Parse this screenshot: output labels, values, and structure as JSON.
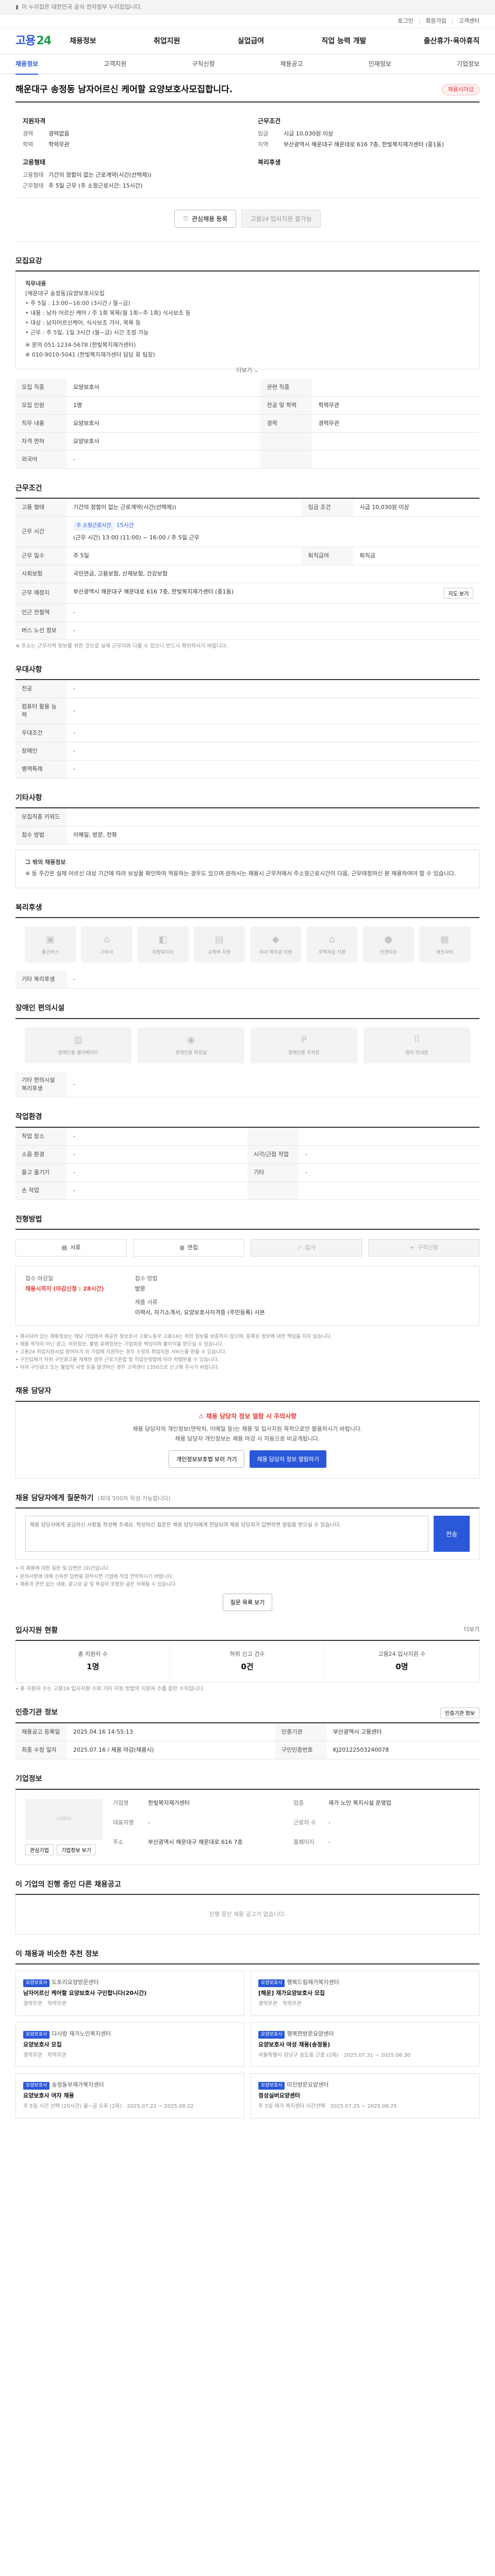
{
  "topbar": {
    "notice": "이 누리집은 대한민국 공식 전자정부 누리집입니다."
  },
  "topstrip": {
    "links": [
      "로그인",
      "회원가입",
      "고객센터"
    ]
  },
  "gnb": {
    "logo_a": "고용",
    "logo_b": "24",
    "menu": [
      "채용정보",
      "취업지원",
      "실업급여",
      "직업 능력 개발",
      "출산휴가·육아휴직"
    ]
  },
  "tabs": [
    "채용정보",
    "고객지원",
    "구직신청",
    "채용공고",
    "인재정보",
    "기업정보"
  ],
  "title": "해운대구 송정동 남자어르신 케어할 요양보호사모집합니다.",
  "closing_badge": "채용시마감",
  "summary": {
    "left_title": "지원자격",
    "left": [
      {
        "k": "경력",
        "v": "경력없음"
      },
      {
        "k": "학력",
        "v": "학력무관"
      }
    ],
    "right_title": "근무조건",
    "right": [
      {
        "k": "임금",
        "v": "시급 10,030원 이상"
      },
      {
        "k": "지역",
        "v": "부산광역시 해운대구 해운대로 616 7층, 한빛복지재가센터 (중1동)"
      }
    ],
    "left2_title": "고용형태",
    "left2": [
      {
        "k": "고용형태",
        "v": "기간의 정함이 없는 근로계약(시간(선택제))"
      },
      {
        "k": "근무형태",
        "v": "주 5일 근무 (주 소정근로시간: 15시간)"
      }
    ],
    "right2_title": "복리후생",
    "right2": []
  },
  "buttons": {
    "save": "관심채용 등록",
    "apply": "고용24 입사지원 불가능"
  },
  "sec_detail": {
    "title": "모집요강",
    "lines": [
      "직무내용",
      "[해운대구 송정동]요양보호사모집",
      "• 주 5일 : 13:00~16:00 (3시간 / 월~금)",
      "• 내용 : 남자 어르신 케어 / 주 1회 목욕(월 1회~주 1회) 식사보조 등",
      "• 대상 : 남자어르신케어, 식사보조 가사, 목욕 등",
      "• 근무 : 주 5일, 1일 3시간 (월~금) 시간 조정 가능",
      "",
      "※ 문의 051-1234-5678 (한빛복지재가센터)",
      "",
      "※ 010-9010-5041 (한빛복지재가센터 담당 류 팀장)"
    ],
    "more": "더보기"
  },
  "sec_job": {
    "title": "",
    "rows": [
      [
        {
          "k": "모집 직종",
          "v": "요양보호사"
        },
        {
          "k": "관련 직종",
          "v": ""
        }
      ],
      [
        {
          "k": "모집 인원",
          "v": "1명"
        },
        {
          "k": "전공 및 학력",
          "v": "학력무관"
        }
      ],
      [
        {
          "k": "직무 내용",
          "v": "요양보호사"
        },
        {
          "k": "경력",
          "v": "경력무관"
        }
      ],
      [
        {
          "k": "자격 면허",
          "v": "요양보호사"
        },
        {
          "k": "",
          "v": ""
        }
      ],
      [
        {
          "k": "외국어",
          "v": "-"
        },
        {
          "k": "",
          "v": ""
        }
      ]
    ]
  },
  "sec_work": {
    "title": "근무조건",
    "employment": "기간의 정함이 없는 근로계약(시간(선택제))",
    "wage_label": "임금 조건",
    "wage": "시급 10,030원 이상",
    "hours_label": "근무 시간",
    "hours_tag": "주 소정근로시간",
    "hours_value": "15시간",
    "schedule": "(근무 시간) 13:00 (11:00) ~ 16:00 / 주 5일 근무",
    "days": "주 5일",
    "insurance": "국민연금, 고용보험, 산재보험, 건강보험",
    "severance": "퇴직금",
    "location": "부산광역시 해운대구 해운대로 616 7층, 한빛복지재가센터 (중1동)",
    "map_btn": "지도 보기",
    "note": "※ 주소는 근무지역 정보를 위한 것으로 실제 근무지와 다를 수 있으니 반드시 확인하시기 바랍니다."
  },
  "sec_pref": {
    "title": "우대사항",
    "rows": [
      {
        "k": "전공",
        "v": "-"
      },
      {
        "k": "컴퓨터 활용 능력",
        "v": "-"
      },
      {
        "k": "우대조건",
        "v": "-"
      },
      {
        "k": "장애인",
        "v": "-"
      },
      {
        "k": "병역특례",
        "v": "-"
      }
    ]
  },
  "sec_etc": {
    "title": "기타사항",
    "rows": [
      {
        "k": "모집직종 키워드",
        "v": ""
      },
      {
        "k": "접수 방법",
        "v": "이메일, 방문, 전화"
      }
    ],
    "note_title": "그 밖의 채용정보",
    "note": "※ 등 주간은 실제 어르신 대상 기간에 따라 보상을 확인하여 적응하는 경우도 있으며 원하시는 채용시 근무처에서 주소정근로시간이 다음, 근무태정하신 분 채용하여야 할 수 있습니다."
  },
  "sec_welfare": {
    "title": "복리후생",
    "items": [
      "통근버스",
      "기숙사",
      "차량유지비",
      "교육비 지원",
      "자녀 학자금 지원",
      "주택자금 지원",
      "인센티브",
      "경조사비"
    ],
    "other_label": "기타 복리후생",
    "other": "-"
  },
  "sec_disabled": {
    "title": "장애인 편의시설",
    "items": [
      "장애인용 엘리베이터",
      "장애인용 화장실",
      "장애인용 주차장",
      "점자 안내판"
    ],
    "other_label": "기타 편의시설 복리후생",
    "other": "-"
  },
  "sec_env": {
    "title": "작업환경",
    "rows": [
      [
        {
          "k": "작업 장소",
          "v": "-"
        },
        {
          "k": "",
          "v": ""
        }
      ],
      [
        {
          "k": "소음 환경",
          "v": "-"
        },
        {
          "k": "시각/근접 작업",
          "v": "-"
        }
      ],
      [
        {
          "k": "들고 옮기기",
          "v": "-"
        },
        {
          "k": "기타",
          "v": "-"
        }
      ],
      [
        {
          "k": "손 작업",
          "v": "-"
        },
        {
          "k": "",
          "v": ""
        }
      ]
    ]
  },
  "sec_apply": {
    "title": "전형방법",
    "docs": [
      "서류",
      "면접",
      "입사",
      "구직신청"
    ],
    "deadline_label": "접수 마감일",
    "deadline": "채용시까지 (마감신청 : 28시간)",
    "method_label": "접수 방법",
    "method": "방문",
    "doc_label": "제출 서류",
    "doc": "이력서, 자기소개서, 요양보호사자격증 (주민등록) 사본",
    "disclaimer": [
      "• 제시되어 있는 채용정보는 해당 기업에서 제공한 정보로서 고용노동부 고용24는 위의 정보를 보증하지 않으며, 등록된 정보에 대한 책임을 지지 않습니다.",
      "• 채용 목적이 아닌 광고, 허위정보, 불법 유해정보는 기업회원 책임이며 불이익을 받으실 수 있습니다.",
      "• 고용24 취업지원사업 참여자가 위 기업에 지원하는 경우 소정의 취업지원 서비스를 받을 수 있습니다.",
      "• 구인업체가 허위 구인광고를 게재한 경우 근로기준법 및 직업안정법에 따라 처벌받을 수 있습니다.",
      "• 허위 구인광고 또는 불법적 사항 등을 발견하신 경우 고객센터 1350으로 신고해 주시기 바랍니다."
    ]
  },
  "sec_contact": {
    "title": "채용 담당자",
    "warn": "채용 담당자 정보 열람 시 주의사항",
    "lines": [
      "채용 담당자의 개인정보(연락처, 이메일 등)는 채용 및 입사지원 목적으로만 활용하시기 바랍니다.",
      "채용 담당자 개인정보는 채용 마감 시 자동으로 비공개됩니다."
    ],
    "btn1": "개인정보보호법 보러 가기",
    "btn2": "채용 담당자 정보 열람하기"
  },
  "sec_qa": {
    "title": "채용 담당자에게 질문하기",
    "sub": "(최대 500자 작성 가능합니다)",
    "placeholder": "채용 담당자에게 궁금하신 사항을 작성해 주세요. 작성하신 질문은 채용 담당자에게 전달되며 채용 담당자가 답변하면 알림을 받으실 수 있습니다.",
    "send": "전송",
    "notes": [
      "• 이 채용에 대한 질문 및 답변은 (0)건입니다.",
      "• 문의사항에 대해 신속한 답변을 원하시면 기업에 직접 연락하시기 바랍니다.",
      "• 채용과 관련 없는 내용, 광고성 글 및 욕설이 포함된 글은 삭제될 수 있습니다."
    ],
    "btn": "질문 목록 보기"
  },
  "sec_stats": {
    "title": "입사지원 현황",
    "link": "더보기",
    "items": [
      {
        "lab": "총 지원자 수",
        "num": "1명"
      },
      {
        "lab": "허위 신고 건수",
        "num": "0건"
      },
      {
        "lab": "고용24 입사지원 수",
        "num": "0명"
      }
    ],
    "note": "• 총 지원자 수는 고용24 입사지원 수와 기타 지원 방법의 지원자 수를 합한 수치입니다."
  },
  "sec_info": {
    "title": "인증기관 정보",
    "btn": "인증기관 정보",
    "rows": [
      [
        {
          "k": "채용공고 등록일",
          "v": "2025.04.16 14:55:13"
        },
        {
          "k": "인증기관",
          "v": "부산광역시 고용센터"
        }
      ],
      [
        {
          "k": "최종 수정 일자",
          "v": "2025.07.16 / 채용 마감(채용시)"
        },
        {
          "k": "구인인증번호",
          "v": "KJ20122503240078"
        }
      ]
    ]
  },
  "sec_company": {
    "title": "기업정보",
    "logo_text": "LOGO",
    "name": "한빛복지재가센터",
    "rows": [
      {
        "k": "기업명",
        "v": "한빛복지재가센터"
      },
      {
        "k": "업종",
        "v": "재가 노인 복지시설 운영업"
      },
      {
        "k": "대표자명",
        "v": "-"
      },
      {
        "k": "근로자 수",
        "v": "-"
      },
      {
        "k": "주소",
        "v": "부산광역시 해운대구 해운대로 616 7층"
      },
      {
        "k": "홈페이지",
        "v": "-"
      }
    ],
    "btn1": "관심기업",
    "btn2": "기업정보 보기"
  },
  "sec_other": {
    "title": "이 기업의 진행 중인 다른 채용공고",
    "empty": "진행 중인 채용 공고가 없습니다."
  },
  "sec_reco": {
    "title": "이 채용과 비슷한 추천 정보",
    "items": [
      {
        "tag": "요양보호사",
        "co": "도토리요양방문센터",
        "title": "남자어르신 케어할 요양보호사 구인합니다(20시간)",
        "m1": "경력무관",
        "m2": "학력무관"
      },
      {
        "tag": "요양보호사",
        "co": "행복드림재가복지센터",
        "title": "[해운] 재가요양보호사 모집",
        "m1": "경력무관",
        "m2": "학력무관"
      },
      {
        "tag": "요양보호사",
        "co": "다사랑 재가노인복지센터",
        "title": "요양보호사 모집",
        "m1": "경력무관",
        "m2": "학력무관"
      },
      {
        "tag": "요양보호사",
        "co": "행복한방문요양센터",
        "title": "요양보호사 여성 채용(송정동)",
        "m1": "서울특별시 강남구 송도동 근로 (2회)",
        "m2": "2025.07.31 ~ 2025.08.30"
      },
      {
        "tag": "요양보호사",
        "co": "송정동부재가복지센터",
        "title": "요양보호사 여자 채용",
        "m1": "주 5일 시간 선택 (20시간) 월~금 오후 (2회)",
        "m2": "2025.07.22 ~ 2025.08.22"
      },
      {
        "tag": "요양보호사",
        "co": "미진방문요양센터",
        "title": "정성실버요양센터",
        "m1": "주 5일 재가 복지센터 시간선택",
        "m2": "2025.07.25 ~ 2025.08.25"
      }
    ]
  }
}
